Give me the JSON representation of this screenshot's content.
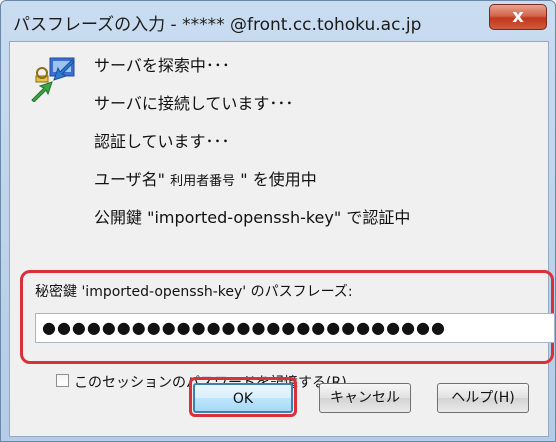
{
  "window": {
    "title": "パスフレーズの入力 -  ***** @front.cc.tohoku.ac.jp",
    "close_label": "x"
  },
  "status": {
    "lines": [
      "サーバを探索中･･･",
      "サーバに接続しています･･･",
      "認証しています･･･"
    ],
    "user_prefix": "ユーザ名\" ",
    "user_name": "利用者番号",
    "user_suffix": " \" を使用中",
    "pubkey_line": "公開鍵 \"imported-openssh-key\" で認証中"
  },
  "passphrase": {
    "label": "秘密鍵 'imported-openssh-key' のパスフレーズ:",
    "value": "●●●●●●●●●●●●●●●●●●●●●●●●●●●"
  },
  "remember": {
    "label": "このセッションのパスワードを記憶する(R)",
    "checked": false
  },
  "buttons": {
    "ok": "OK",
    "cancel": "キャンセル",
    "help": "ヘルプ(H)"
  },
  "icons": {
    "app": "key-connect-icon",
    "close": "close-icon"
  },
  "colors": {
    "highlight": "#d9303a",
    "close": "#c0381d"
  }
}
